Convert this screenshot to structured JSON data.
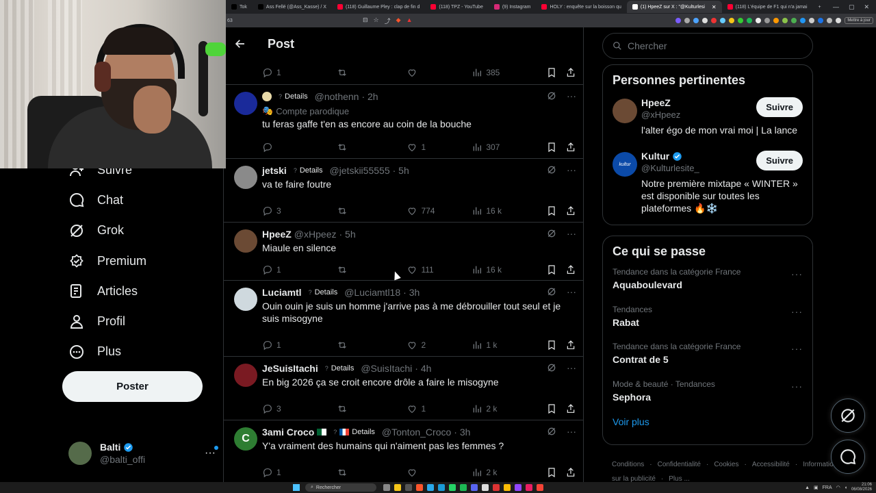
{
  "browser": {
    "tabs": [
      {
        "label": "Tok",
        "color": "#000000",
        "active": false
      },
      {
        "label": "Ass Fellé (@Ass_Kasse) / X",
        "color": "#000000",
        "active": false
      },
      {
        "label": "(118) Guillaume Pley : clap de fin d",
        "color": "#ff0033",
        "active": false
      },
      {
        "label": "(118) TPZ - YouTube",
        "color": "#ff0033",
        "active": false
      },
      {
        "label": "(9) Instagram",
        "color": "#d62976",
        "active": false
      },
      {
        "label": "HOLY : enquête sur la boisson qu",
        "color": "#ff0033",
        "active": false
      },
      {
        "label": "(1) HpeeZ sur X : \"@Kulturlesi",
        "color": "#ffffff",
        "active": true
      },
      {
        "label": "(118) L'équipe de F1 qui n'a jamai",
        "color": "#ff0033",
        "active": false
      }
    ],
    "address_fragment": "63",
    "mettre_label": "Mettre à jour"
  },
  "sidebar": {
    "items": [
      {
        "label": "Suivre",
        "icon": "person-plus-icon"
      },
      {
        "label": "Chat",
        "icon": "chat-bubble-icon"
      },
      {
        "label": "Grok",
        "icon": "grok-icon"
      },
      {
        "label": "Premium",
        "icon": "premium-badge-icon"
      },
      {
        "label": "Articles",
        "icon": "article-icon"
      },
      {
        "label": "Profil",
        "icon": "profile-icon"
      },
      {
        "label": "Plus",
        "icon": "more-circle-icon"
      }
    ],
    "post_button": "Poster",
    "account": {
      "name": "Balti",
      "handle": "@balti_offi",
      "more": "···"
    }
  },
  "main": {
    "title": "Post",
    "first_actions": {
      "replies": "1",
      "likes": "",
      "views": "385"
    },
    "details_label": "Details",
    "tweets": [
      {
        "name": "",
        "handle": "@nothenn",
        "time": "· 2h",
        "parody": "Compte parodique",
        "text": "tu feras gaffe t'en as encore au coin de la bouche",
        "replies": "",
        "likes": "1",
        "views": "307",
        "avatar_color": "#1a2a9a",
        "has_name_dot": true
      },
      {
        "name": "jetski",
        "handle": "@jetskii55555",
        "time": "· 5h",
        "parody": "",
        "text": "va te faire foutre",
        "replies": "3",
        "likes": "774",
        "views": "16 k",
        "avatar_color": "#8a8a8a"
      },
      {
        "name": "HpeeZ",
        "handle": "@xHpeez",
        "time": "· 5h",
        "parody": "",
        "text": "Miaule en silence",
        "replies": "1",
        "likes": "111",
        "views": "16 k",
        "avatar_color": "#6b4a34",
        "no_details": true
      },
      {
        "name": "Luciamtl",
        "handle": "@Luciamtl18",
        "time": "· 3h",
        "parody": "",
        "text": "Ouin ouin je suis un homme j'arrive pas à me débrouiller tout seul et je suis misogyne",
        "replies": "1",
        "likes": "2",
        "views": "1 k",
        "avatar_color": "#cfd9de"
      },
      {
        "name": "JeSuisItachi",
        "handle": "@SuisItachi",
        "time": "· 4h",
        "parody": "",
        "text": "En big 2026 ça se croit encore drôle a faire le misogyne",
        "replies": "3",
        "likes": "1",
        "views": "2 k",
        "avatar_color": "#7a1a22"
      },
      {
        "name": "3ami Croco",
        "handle": "@Tonton_Croco",
        "time": "· 3h",
        "parody": "",
        "text": "Y'a vraiment des humains qui n'aiment pas les femmes ?",
        "replies": "1",
        "likes": "",
        "views": "2 k",
        "avatar_color": "#2e7d32",
        "avatar_letter": "C",
        "flags": true
      }
    ]
  },
  "right": {
    "search_placeholder": "Chercher",
    "relevant_title": "Personnes pertinentes",
    "people": [
      {
        "name": "HpeeZ",
        "handle": "@xHpeez",
        "bio": "l'alter égo de mon vrai moi | La lance",
        "follow": "Suivre",
        "verified": false,
        "avatar_color": "#6b4a34"
      },
      {
        "name": "Kultur",
        "handle": "@Kulturlesite_",
        "bio": "Notre première mixtape « WINTER » est disponible sur toutes les plateformes 🔥❄️",
        "follow": "Suivre",
        "verified": true,
        "avatar_color": "#0b4aa8",
        "avatar_text": "kultur"
      }
    ],
    "trends_title": "Ce qui se passe",
    "trends": [
      {
        "context": "Tendance dans la catégorie France",
        "name": "Aquaboulevard"
      },
      {
        "context": "Tendances",
        "name": "Rabat"
      },
      {
        "context": "Tendance dans la catégorie France",
        "name": "Contrat de 5"
      },
      {
        "context": "Mode & beauté · Tendances",
        "name": "Sephora"
      }
    ],
    "show_more": "Voir plus",
    "footer_links": [
      "Conditions",
      "·",
      "Confidentialité",
      "·",
      "Cookies",
      "·",
      "Accessibilité",
      "·",
      "Informations sur la publicité",
      "·",
      "Plus ..."
    ]
  },
  "taskbar": {
    "search": "Rechercher",
    "lang": "FRA",
    "time": "21:06",
    "date": "06/08/2026"
  },
  "colors": {
    "accent": "#1d9bf0",
    "border": "#2f3336",
    "muted": "#71767b",
    "verified": "#1d9bf0"
  }
}
